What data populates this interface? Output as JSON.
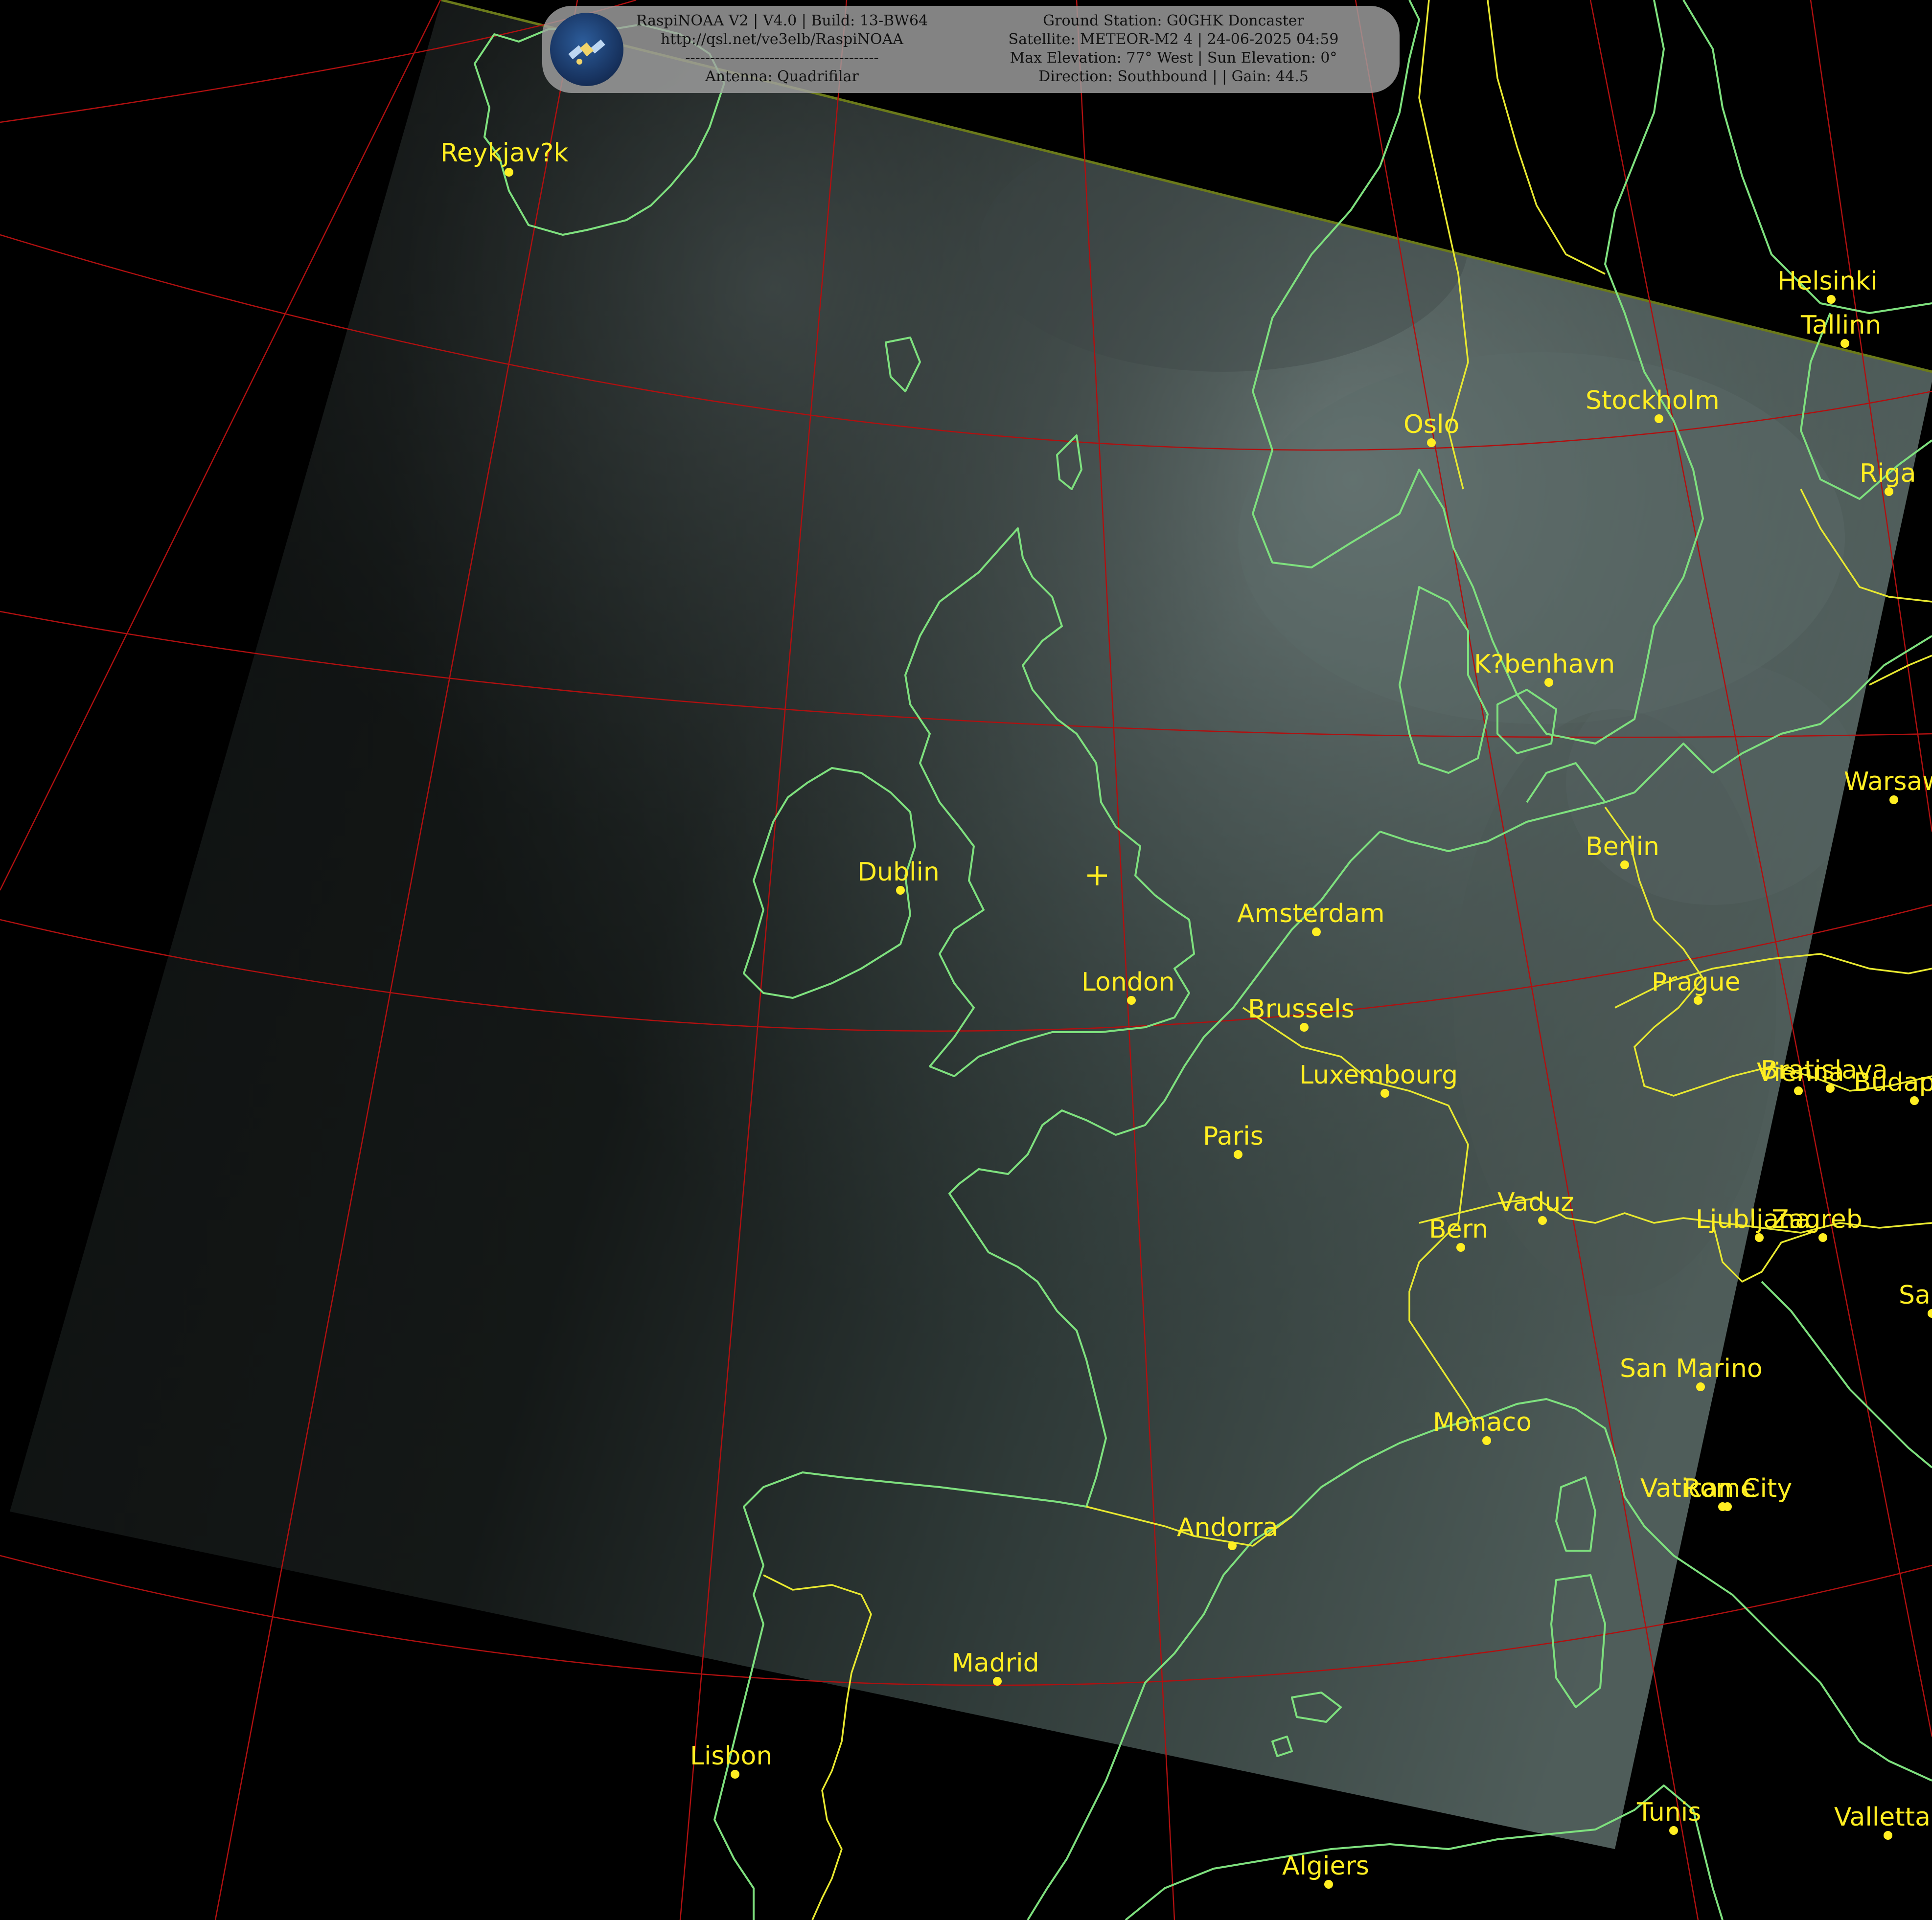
{
  "header": {
    "left_lines": [
      "RaspiNOAA V2 | V4.0 | Build: 13-BW64",
      "http://qsl.net/ve3elb/RaspiNOAA",
      "---------------------------------------",
      "Antenna: Quadrifilar"
    ],
    "right_lines": [
      "Ground Station: G0GHK Doncaster",
      "Satellite: METEOR-M2 4 | 24-06-2025 04:59",
      "Max Elevation: 77° West | Sun Elevation: 0°",
      "Direction: Southbound | | Gain: 44.5"
    ],
    "logo_icon": "satellite-icon"
  },
  "cities": [
    {
      "name": "Reykjav?k"
    },
    {
      "name": "Helsinki"
    },
    {
      "name": "Tallinn"
    },
    {
      "name": "Stockholm"
    },
    {
      "name": "Oslo"
    },
    {
      "name": "Riga"
    },
    {
      "name": "K?benhavn"
    },
    {
      "name": "Warsaw"
    },
    {
      "name": "Berlin"
    },
    {
      "name": "Dublin"
    },
    {
      "name": "Amsterdam"
    },
    {
      "name": "London"
    },
    {
      "name": "Prague"
    },
    {
      "name": "Brussels"
    },
    {
      "name": "Luxembourg"
    },
    {
      "name": "Bratislava"
    },
    {
      "name": "Vienna"
    },
    {
      "name": "Budapest"
    },
    {
      "name": "Paris"
    },
    {
      "name": "Vaduz"
    },
    {
      "name": "Bern"
    },
    {
      "name": "Ljubljana"
    },
    {
      "name": "Zagreb"
    },
    {
      "name": "Sarajevo"
    },
    {
      "name": "San Marino"
    },
    {
      "name": "Monaco"
    },
    {
      "name": "Vatican City"
    },
    {
      "name": "Rome"
    },
    {
      "name": "Andorra"
    },
    {
      "name": "Madrid"
    },
    {
      "name": "Lisbon"
    },
    {
      "name": "Tunis"
    },
    {
      "name": "Valletta"
    },
    {
      "name": "Algiers"
    }
  ],
  "colors": {
    "label": "#ffee22",
    "coast": "#7ee07e",
    "graticule": "#b01010",
    "border": "#e8e830",
    "background": "#000000"
  }
}
